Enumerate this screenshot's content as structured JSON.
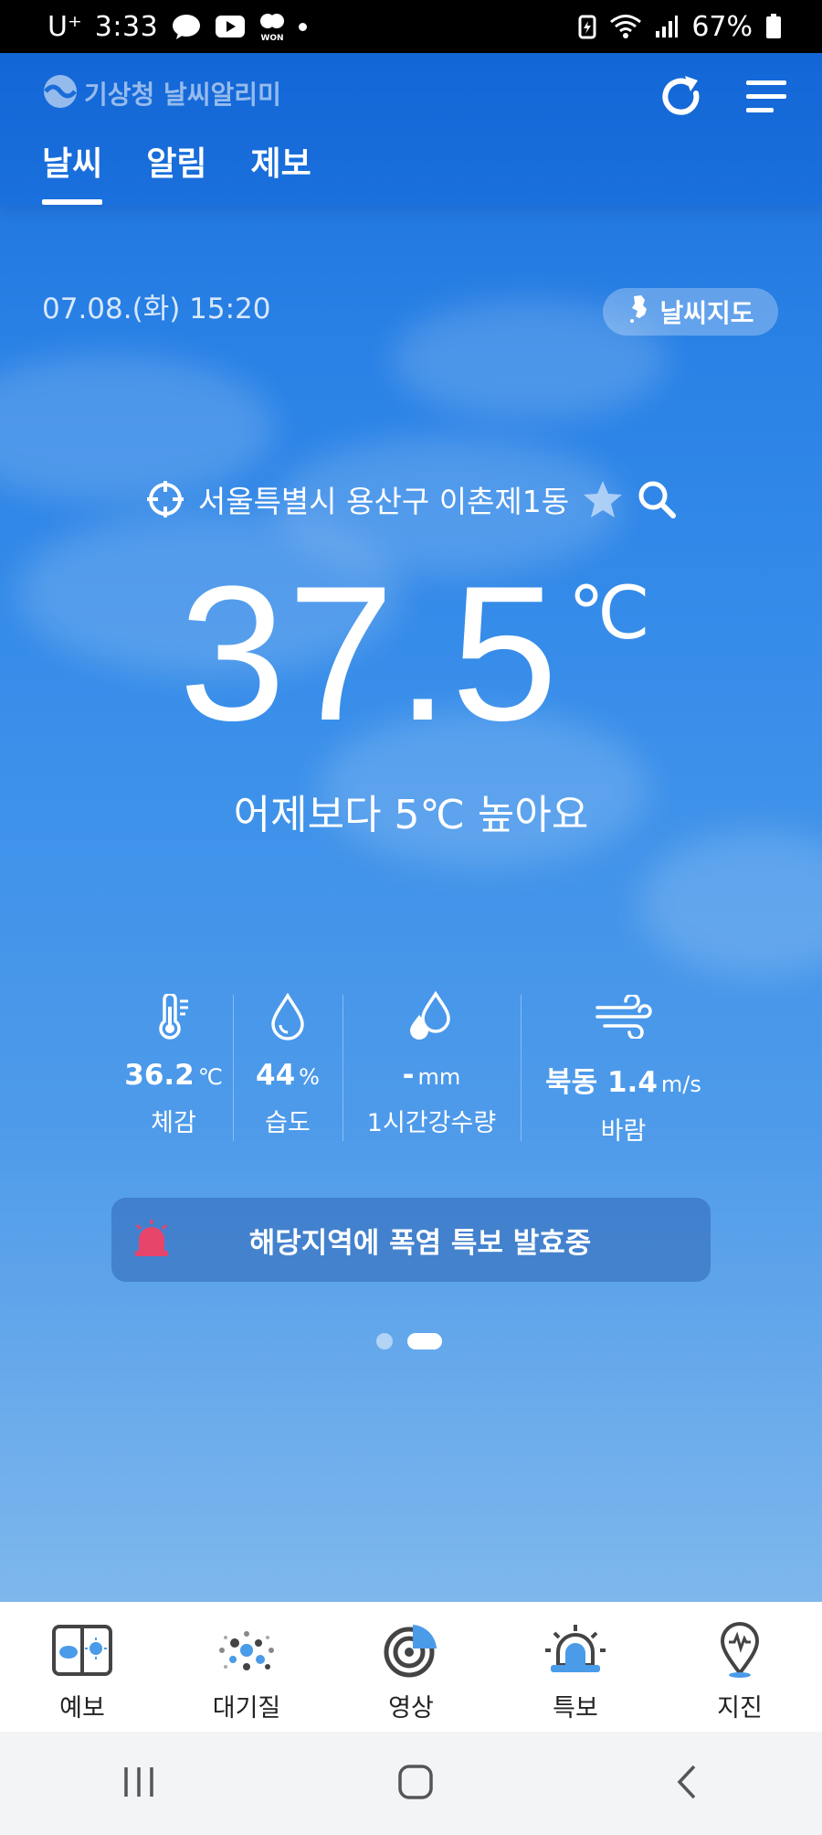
{
  "status_bar": {
    "carrier": "U⁺",
    "time": "3:33",
    "battery_percent": "67%",
    "icons": [
      "talk-icon",
      "youtube-icon",
      "won-icon",
      "notification-dot",
      "battery-saver-icon",
      "wifi-icon",
      "signal-icon",
      "battery-icon"
    ]
  },
  "header": {
    "app_name": "기상청 날씨알리미",
    "tabs": [
      {
        "label": "날씨",
        "active": true
      },
      {
        "label": "알림",
        "active": false
      },
      {
        "label": "제보",
        "active": false
      }
    ]
  },
  "main": {
    "datetime": "07.08.(화) 15:20",
    "weather_map_label": "날씨지도",
    "location": "서울특별시 용산구 이촌제1동",
    "temperature": "37.5",
    "temperature_unit": "℃",
    "comparison": "어제보다 5℃ 높아요",
    "metrics": [
      {
        "value": "36.2",
        "unit": "℃",
        "label": "체감",
        "icon": "thermometer-icon"
      },
      {
        "value": "44",
        "unit": "%",
        "label": "습도",
        "icon": "water-drop-icon"
      },
      {
        "value": "-",
        "unit": "mm",
        "label": "1시간강수량",
        "icon": "rain-drops-icon"
      },
      {
        "value": "북동 1.4",
        "unit": "m/s",
        "label": "바람",
        "icon": "wind-icon"
      }
    ],
    "alert_text": "해당지역에 폭염 특보 발효중",
    "pagination": {
      "total": 2,
      "active": 2
    }
  },
  "bottom_nav": [
    {
      "label": "예보",
      "icon": "forecast-icon"
    },
    {
      "label": "대기질",
      "icon": "air-quality-icon"
    },
    {
      "label": "영상",
      "icon": "radar-icon"
    },
    {
      "label": "특보",
      "icon": "warning-siren-icon"
    },
    {
      "label": "지진",
      "icon": "earthquake-icon"
    }
  ],
  "colors": {
    "header_blue": "#1366d6",
    "sky_top": "#2a82e6",
    "sky_bottom": "#7eb7ec",
    "siren_red": "#e8456b",
    "nav_icon_blue": "#4a9be8"
  }
}
